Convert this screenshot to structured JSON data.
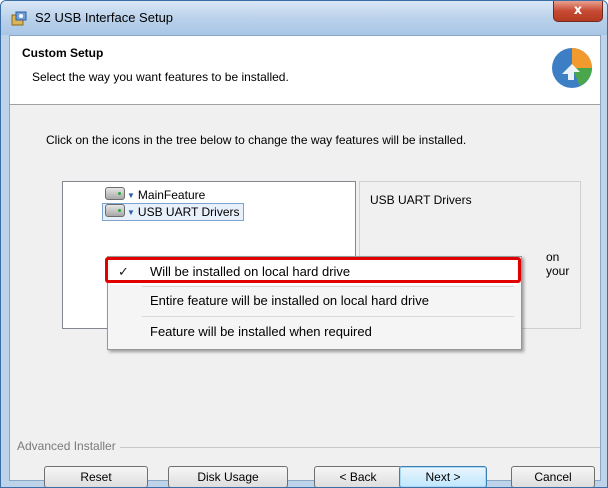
{
  "window": {
    "title": "S2 USB Interface Setup",
    "close_glyph": "x"
  },
  "header": {
    "title": "Custom Setup",
    "subtitle": "Select the way you want features to be installed."
  },
  "instructions": "Click on the icons in the tree below to change the way features will be installed.",
  "tree": {
    "items": [
      {
        "label": "MainFeature"
      },
      {
        "label": "USB UART Drivers",
        "selected": true
      }
    ]
  },
  "description": {
    "title": "USB UART Drivers",
    "partial_text": "on your"
  },
  "context_menu": {
    "items": [
      {
        "label": "Will be installed on local hard drive",
        "checked": true,
        "check_glyph": "✓"
      },
      {
        "label": "Entire feature will be installed on local hard drive"
      },
      {
        "label": "Feature will be installed when required"
      }
    ]
  },
  "footer": {
    "brand": "Advanced Installer"
  },
  "buttons": {
    "reset": "Reset",
    "disk_usage": "Disk Usage",
    "back": "< Back",
    "next": "Next >",
    "cancel": "Cancel"
  },
  "colors": {
    "highlight_box": "#e00000",
    "title_bar": "#b8d0ea",
    "close_button": "#c74a33"
  }
}
